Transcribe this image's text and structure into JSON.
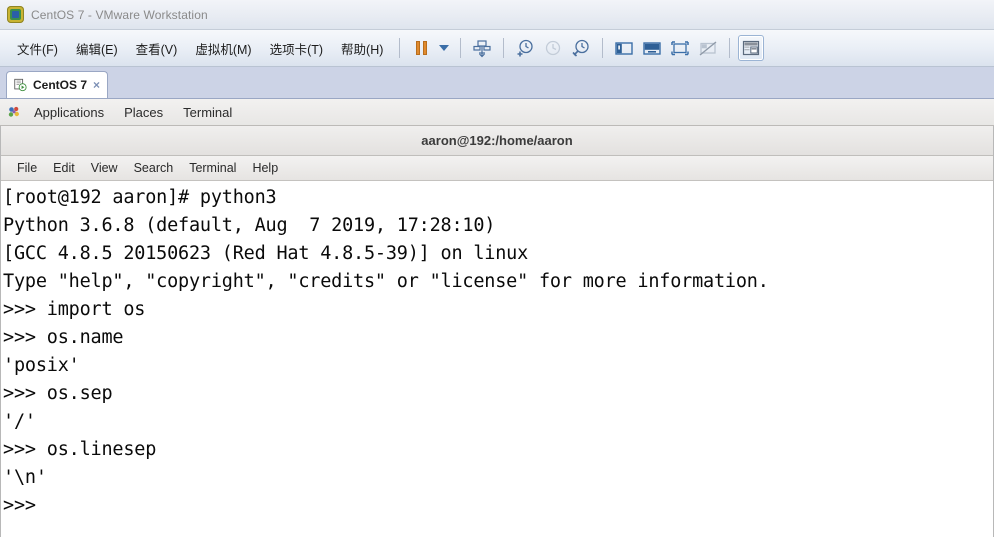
{
  "window": {
    "title": "CentOS 7 - VMware Workstation",
    "logo_icon": "vmware-logo-icon"
  },
  "menu": {
    "items": [
      {
        "label": "文件(F)",
        "name": "menu-file"
      },
      {
        "label": "编辑(E)",
        "name": "menu-edit"
      },
      {
        "label": "查看(V)",
        "name": "menu-view"
      },
      {
        "label": "虚拟机(M)",
        "name": "menu-vm"
      },
      {
        "label": "选项卡(T)",
        "name": "menu-tabs"
      },
      {
        "label": "帮助(H)",
        "name": "menu-help"
      }
    ]
  },
  "toolbar": {
    "buttons": [
      {
        "name": "suspend-button",
        "icon": "pause-icon"
      },
      {
        "name": "power-dropdown-button",
        "icon": "chevron-down-icon"
      },
      {
        "name": "snapshot-button",
        "icon": "snapshot-icon"
      },
      {
        "name": "take-snapshot-button",
        "icon": "clock-plus-icon"
      },
      {
        "name": "revert-snapshot-button",
        "icon": "clock-revert-icon"
      },
      {
        "name": "snapshot-manager-button",
        "icon": "clock-wrench-icon"
      },
      {
        "name": "show-library-button",
        "icon": "sidebar-panel-icon"
      },
      {
        "name": "show-console-view-button",
        "icon": "console-view-icon"
      },
      {
        "name": "full-screen-button",
        "icon": "fullscreen-icon"
      },
      {
        "name": "unity-mode-button",
        "icon": "unity-disabled-icon"
      },
      {
        "name": "show-thumbnail-bar-button",
        "icon": "thumbnail-bar-icon"
      }
    ]
  },
  "vm_tabs": {
    "tabs": [
      {
        "label": "CentOS 7",
        "close_label": "×",
        "name": "vm-tab-centos7"
      }
    ]
  },
  "gnome_panel": {
    "items": [
      {
        "label": "Applications",
        "name": "panel-applications"
      },
      {
        "label": "Places",
        "name": "panel-places"
      },
      {
        "label": "Terminal",
        "name": "panel-terminal"
      }
    ]
  },
  "terminal": {
    "title": "aaron@192:/home/aaron",
    "menu": [
      {
        "label": "File",
        "name": "terminal-menu-file"
      },
      {
        "label": "Edit",
        "name": "terminal-menu-edit"
      },
      {
        "label": "View",
        "name": "terminal-menu-view"
      },
      {
        "label": "Search",
        "name": "terminal-menu-search"
      },
      {
        "label": "Terminal",
        "name": "terminal-menu-terminal"
      },
      {
        "label": "Help",
        "name": "terminal-menu-help"
      }
    ],
    "lines": [
      "[root@192 aaron]# python3",
      "Python 3.6.8 (default, Aug  7 2019, 17:28:10)",
      "[GCC 4.8.5 20150623 (Red Hat 4.8.5-39)] on linux",
      "Type \"help\", \"copyright\", \"credits\" or \"license\" for more information.",
      ">>> import os",
      ">>> os.name",
      "'posix'",
      ">>> os.sep",
      "'/'",
      ">>> os.linesep",
      "'\\n'",
      ">>>"
    ]
  },
  "colors": {
    "titlebar_text": "#8a8a8a",
    "tabstrip_bg": "#ccd3e6",
    "accent_orange": "#e08a2e",
    "accent_blue": "#3a6ea8",
    "terminal_fg": "#0a0a0a",
    "terminal_bg": "#ffffff"
  }
}
